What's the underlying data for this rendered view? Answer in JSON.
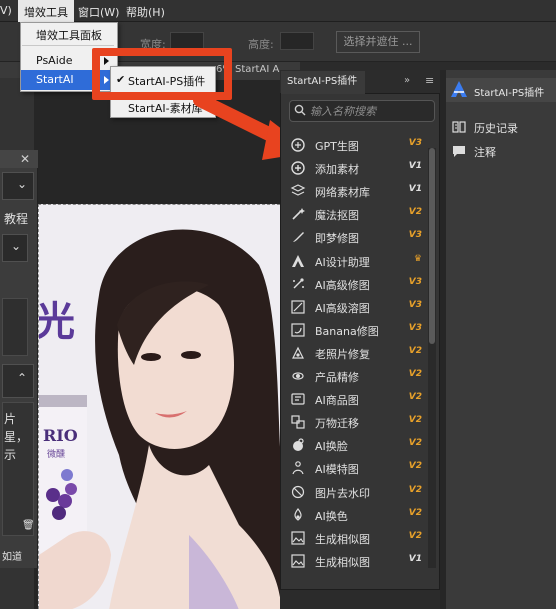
{
  "menubar": {
    "items": [
      {
        "label": "V)"
      },
      {
        "label": "增效工具"
      },
      {
        "label": "窗口(W)"
      },
      {
        "label": "帮助(H)"
      }
    ]
  },
  "optionsbar": {
    "width_label": "宽度:",
    "height_label": "高度:",
    "select_mask_label": "选择并遮住 ..."
  },
  "doctab": {
    "text": "6% StartAI A"
  },
  "dropdown": {
    "items": [
      "增效工具面板",
      "PsAide",
      "StartAI"
    ]
  },
  "submenu": {
    "items": [
      {
        "label": "StartAI-PS插件",
        "checked": true,
        "check": "✔"
      },
      {
        "label": "StartAI-素材库",
        "checked": false
      }
    ]
  },
  "left_panel": {
    "label_tutorial": "教程",
    "label_chars": [
      "片",
      "星，",
      "示"
    ],
    "label_bottom": "如道"
  },
  "photo": {
    "can_brand": "RIO",
    "can_sub": "微醺",
    "purple_glyph": "光"
  },
  "plugin": {
    "tab_label": "StartAI-PS插件",
    "collapse": "»",
    "menu_glyph": "≡",
    "search_placeholder": "输入名称搜索",
    "tools": [
      {
        "label": "GPT生图",
        "badge": "V3",
        "icon": "gpt-icon"
      },
      {
        "label": "添加素材",
        "badge": "V1",
        "icon": "add-material-icon"
      },
      {
        "label": "网络素材库",
        "badge": "V1",
        "icon": "layers-icon"
      },
      {
        "label": "魔法抠图",
        "badge": "V2",
        "icon": "magic-cutout-icon"
      },
      {
        "label": "即梦修图",
        "badge": "V3",
        "icon": "brush-icon"
      },
      {
        "label": "AI设计助理",
        "badge": "crown",
        "icon": "ai-design-icon"
      },
      {
        "label": "AI高级修图",
        "badge": "V3",
        "icon": "sparkle-icon"
      },
      {
        "label": "AI高级溶图",
        "badge": "V3",
        "icon": "blend-icon"
      },
      {
        "label": "Banana修图",
        "badge": "V3",
        "icon": "banana-edit-icon"
      },
      {
        "label": "老照片修复",
        "badge": "V2",
        "icon": "old-photo-icon"
      },
      {
        "label": "产品精修",
        "badge": "V2",
        "icon": "product-refine-icon"
      },
      {
        "label": "AI商品图",
        "badge": "V2",
        "icon": "ai-product-icon"
      },
      {
        "label": "万物迁移",
        "badge": "V2",
        "icon": "transfer-icon"
      },
      {
        "label": "AI换脸",
        "badge": "V2",
        "icon": "face-swap-icon"
      },
      {
        "label": "AI模特图",
        "badge": "V2",
        "icon": "model-icon"
      },
      {
        "label": "图片去水印",
        "badge": "V2",
        "icon": "watermark-remove-icon"
      },
      {
        "label": "AI换色",
        "badge": "V2",
        "icon": "recolor-icon"
      },
      {
        "label": "生成相似图",
        "badge": "V2",
        "icon": "similar-image-icon"
      },
      {
        "label": "生成相似图",
        "badge": "V1",
        "icon": "similar-image-icon"
      }
    ]
  },
  "right_dock": {
    "header": "StartAI-PS插件",
    "items": [
      {
        "label": "历史记录",
        "icon": "history-icon"
      },
      {
        "label": "注释",
        "icon": "comment-icon"
      }
    ]
  },
  "colors": {
    "accent": "#2f6cd8",
    "highlight_red": "#e8431f",
    "badge_v3": "#e8a12a",
    "badge_v2": "#e8a12a",
    "badge_v1": "#e0e0e0"
  }
}
